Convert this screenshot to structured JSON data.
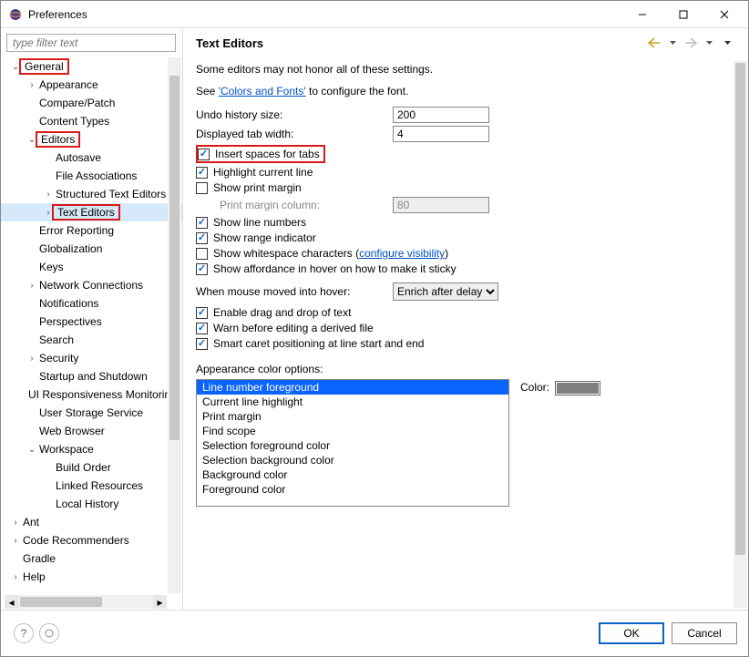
{
  "window": {
    "title": "Preferences"
  },
  "sidebar": {
    "filter_placeholder": "type filter text",
    "items": [
      {
        "label": "General",
        "depth": 0,
        "twisty": "open",
        "red": true
      },
      {
        "label": "Appearance",
        "depth": 1,
        "twisty": "closed"
      },
      {
        "label": "Compare/Patch",
        "depth": 1,
        "twisty": "none"
      },
      {
        "label": "Content Types",
        "depth": 1,
        "twisty": "none"
      },
      {
        "label": "Editors",
        "depth": 1,
        "twisty": "open",
        "red": true
      },
      {
        "label": "Autosave",
        "depth": 2,
        "twisty": "none"
      },
      {
        "label": "File Associations",
        "depth": 2,
        "twisty": "none"
      },
      {
        "label": "Structured Text Editors",
        "depth": 2,
        "twisty": "closed"
      },
      {
        "label": "Text Editors",
        "depth": 2,
        "twisty": "closed",
        "red": true,
        "selected": true
      },
      {
        "label": "Error Reporting",
        "depth": 1,
        "twisty": "none"
      },
      {
        "label": "Globalization",
        "depth": 1,
        "twisty": "none"
      },
      {
        "label": "Keys",
        "depth": 1,
        "twisty": "none"
      },
      {
        "label": "Network Connections",
        "depth": 1,
        "twisty": "closed"
      },
      {
        "label": "Notifications",
        "depth": 1,
        "twisty": "none"
      },
      {
        "label": "Perspectives",
        "depth": 1,
        "twisty": "none"
      },
      {
        "label": "Search",
        "depth": 1,
        "twisty": "none"
      },
      {
        "label": "Security",
        "depth": 1,
        "twisty": "closed"
      },
      {
        "label": "Startup and Shutdown",
        "depth": 1,
        "twisty": "none"
      },
      {
        "label": "UI Responsiveness Monitoring",
        "depth": 1,
        "twisty": "none"
      },
      {
        "label": "User Storage Service",
        "depth": 1,
        "twisty": "none"
      },
      {
        "label": "Web Browser",
        "depth": 1,
        "twisty": "none"
      },
      {
        "label": "Workspace",
        "depth": 1,
        "twisty": "open"
      },
      {
        "label": "Build Order",
        "depth": 2,
        "twisty": "none"
      },
      {
        "label": "Linked Resources",
        "depth": 2,
        "twisty": "none"
      },
      {
        "label": "Local History",
        "depth": 2,
        "twisty": "none"
      },
      {
        "label": "Ant",
        "depth": 0,
        "twisty": "closed"
      },
      {
        "label": "Code Recommenders",
        "depth": 0,
        "twisty": "closed"
      },
      {
        "label": "Gradle",
        "depth": 0,
        "twisty": "none"
      },
      {
        "label": "Help",
        "depth": 0,
        "twisty": "closed"
      }
    ]
  },
  "header": {
    "title": "Text Editors"
  },
  "notes": {
    "honor": "Some editors may not honor all of these settings.",
    "see": "See ",
    "colors_fonts": "'Colors and Fonts'",
    "configure": " to configure the font."
  },
  "fields": {
    "undo_label": "Undo history size:",
    "undo_value": "200",
    "tabwidth_label": "Displayed tab width:",
    "tabwidth_value": "4",
    "print_margin_col_label": "Print margin column:",
    "print_margin_col_value": "80",
    "hover_label": "When mouse moved into hover:",
    "hover_value": "Enrich after delay"
  },
  "checkboxes": {
    "insert_spaces": {
      "label": "Insert spaces for tabs",
      "checked": true,
      "red": true
    },
    "highlight_line": {
      "label": "Highlight current line",
      "checked": true
    },
    "show_print_margin": {
      "label": "Show print margin",
      "checked": false
    },
    "show_line_numbers": {
      "label": "Show line numbers",
      "checked": true
    },
    "show_range": {
      "label": "Show range indicator",
      "checked": true
    },
    "show_whitespace": {
      "label": "Show whitespace characters (",
      "checked": false
    },
    "configure_visibility": "configure visibility",
    "whitespace_close": ")",
    "show_affordance": {
      "label": "Show affordance in hover on how to make it sticky",
      "checked": true
    },
    "enable_dnd": {
      "label": "Enable drag and drop of text",
      "checked": true
    },
    "warn_derived": {
      "label": "Warn before editing a derived file",
      "checked": true
    },
    "smart_caret": {
      "label": "Smart caret positioning at line start and end",
      "checked": true
    }
  },
  "color_section": {
    "caption": "Appearance color options:",
    "color_label": "Color:",
    "options": [
      "Line number foreground",
      "Current line highlight",
      "Print margin",
      "Find scope",
      "Selection foreground color",
      "Selection background color",
      "Background color",
      "Foreground color"
    ],
    "selected_index": 0,
    "swatch_hex": "#808080"
  },
  "footer": {
    "ok": "OK",
    "cancel": "Cancel"
  }
}
